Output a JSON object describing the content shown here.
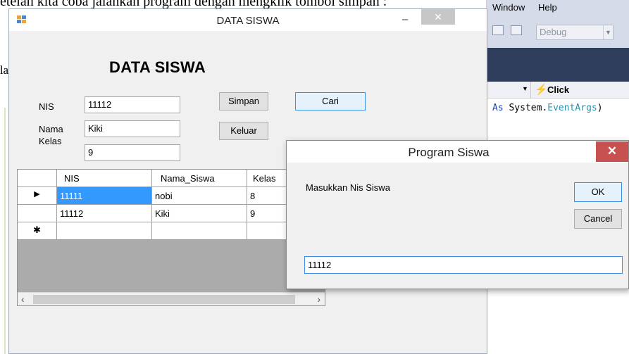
{
  "background": {
    "caption": "etelah kita coba jalankan program dengan mengklik tombol simpan :",
    "left_text": "etelah"
  },
  "ide": {
    "menu": [
      "Window",
      "Help"
    ],
    "config": "Debug",
    "event_label": "Click",
    "code_kw": "As",
    "code_ns": "System.",
    "code_type": "EventArgs",
    "code_tail": ")"
  },
  "form": {
    "title": "DATA SISWA",
    "heading": "DATA SISWA",
    "labels": {
      "nis": "NIS",
      "nama": "Nama",
      "kelas": "Kelas"
    },
    "values": {
      "nis": "11112",
      "nama": "Kiki",
      "kelas": "9"
    },
    "buttons": {
      "simpan": "Simpan",
      "cari": "Cari",
      "keluar": "Keluar"
    },
    "window_controls": {
      "minimize": "–",
      "maximize": "☐",
      "close": "✕"
    }
  },
  "grid": {
    "columns": [
      "NIS",
      "Nama_Siswa",
      "Kelas"
    ],
    "rows": [
      {
        "nis": "11111",
        "nama": "nobi",
        "kelas": "8",
        "marker": "▶"
      },
      {
        "nis": "11112",
        "nama": "Kiki",
        "kelas": "9",
        "marker": ""
      }
    ],
    "new_row_marker": "✱",
    "scroll_left": "‹",
    "scroll_right": "›"
  },
  "dialog": {
    "title": "Program Siswa",
    "prompt": "Masukkan Nis Siswa",
    "ok": "OK",
    "cancel": "Cancel",
    "input_value": "11112",
    "close": "✕"
  }
}
